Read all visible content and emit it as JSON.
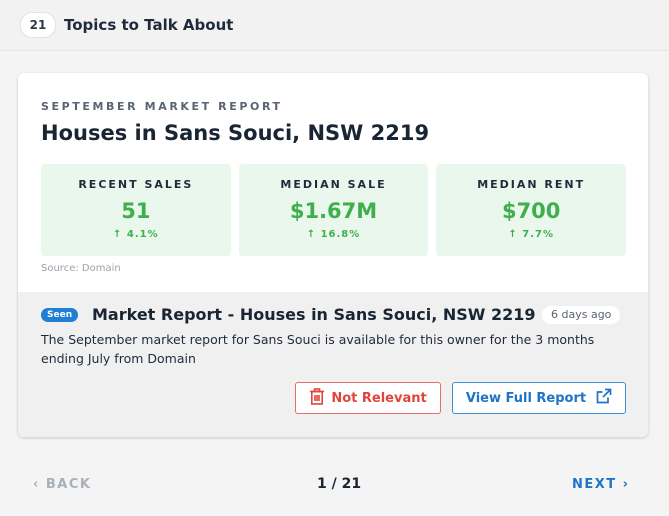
{
  "header": {
    "count": "21",
    "title": "Topics to Talk About"
  },
  "report": {
    "kicker": "SEPTEMBER MARKET REPORT",
    "title": "Houses in Sans Souci, NSW 2219",
    "stats": [
      {
        "label": "RECENT SALES",
        "value": "51",
        "change": "↑ 4.1%"
      },
      {
        "label": "MEDIAN SALE",
        "value": "$1.67M",
        "change": "↑ 16.8%"
      },
      {
        "label": "MEDIAN RENT",
        "value": "$700",
        "change": "↑ 7.7%"
      }
    ],
    "source": "Source: Domain"
  },
  "item": {
    "seen_label": "Seen",
    "title": "Market Report - Houses in Sans Souci, NSW 2219",
    "time_ago": "6 days ago",
    "description": "The September market report for Sans Souci is available for this owner for the 3 months ending July from Domain",
    "not_relevant_label": "Not Relevant",
    "view_report_label": "View Full Report",
    "not_relevant_icon": "trash-icon",
    "view_report_icon": "external-link-icon"
  },
  "pagination": {
    "back_label": "‹ BACK",
    "page": "1 / 21",
    "next_label": "NEXT ›"
  },
  "colors": {
    "accent_green": "#3fae4c",
    "stat_bg": "#e9f7ec",
    "link_blue": "#1f74c8",
    "danger_red": "#e0453b",
    "seen_blue": "#1f7fd4"
  }
}
